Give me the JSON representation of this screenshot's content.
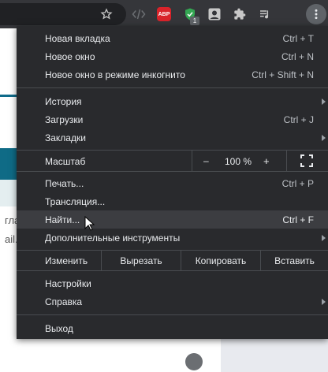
{
  "toolbar": {
    "icons": [
      "star-icon",
      "code-icon",
      "adblock-plus-icon",
      "shield-icon",
      "puzzle-icon",
      "media-icon",
      "menu-icon"
    ],
    "abp_label": "ABP",
    "ext_badge": "1"
  },
  "page_bg": {
    "text1": "гла",
    "text2": "ail."
  },
  "menu": {
    "new_tab": {
      "label": "Новая вкладка",
      "shortcut": "Ctrl + T"
    },
    "new_window": {
      "label": "Новое окно",
      "shortcut": "Ctrl + N"
    },
    "incognito": {
      "label": "Новое окно в режиме инкогнито",
      "shortcut": "Ctrl + Shift + N"
    },
    "history": {
      "label": "История"
    },
    "downloads": {
      "label": "Загрузки",
      "shortcut": "Ctrl + J"
    },
    "bookmarks": {
      "label": "Закладки"
    },
    "zoom": {
      "label": "Масштаб",
      "minus": "–",
      "value": "100 %",
      "plus": "+"
    },
    "print": {
      "label": "Печать...",
      "shortcut": "Ctrl + P"
    },
    "cast": {
      "label": "Трансляция..."
    },
    "find": {
      "label": "Найти...",
      "shortcut": "Ctrl + F"
    },
    "more_tools": {
      "label": "Дополнительные инструменты"
    },
    "edit": {
      "label": "Изменить",
      "cut": "Вырезать",
      "copy": "Копировать",
      "paste": "Вставить"
    },
    "settings": {
      "label": "Настройки"
    },
    "help": {
      "label": "Справка"
    },
    "exit": {
      "label": "Выход"
    }
  }
}
